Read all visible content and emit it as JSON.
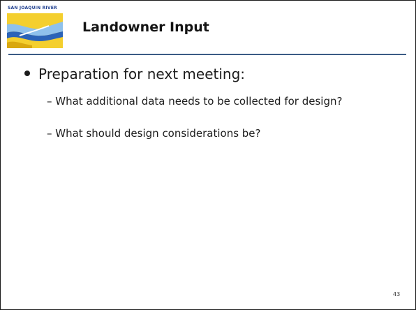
{
  "logo": {
    "text": "SAN JOAQUIN RIVER",
    "colors": {
      "blue": "#1f3f8f",
      "yellow": "#f0c21a",
      "light_blue": "#8fc1ec"
    }
  },
  "slide": {
    "title": "Landowner Input",
    "bullet": "Preparation for next meeting:",
    "subbullets": [
      "– What additional data needs to be collected for design?",
      "– What should design considerations be?"
    ],
    "page_number": "43"
  },
  "colors": {
    "rule": "#3b5b85",
    "text": "#1c1c1c"
  }
}
